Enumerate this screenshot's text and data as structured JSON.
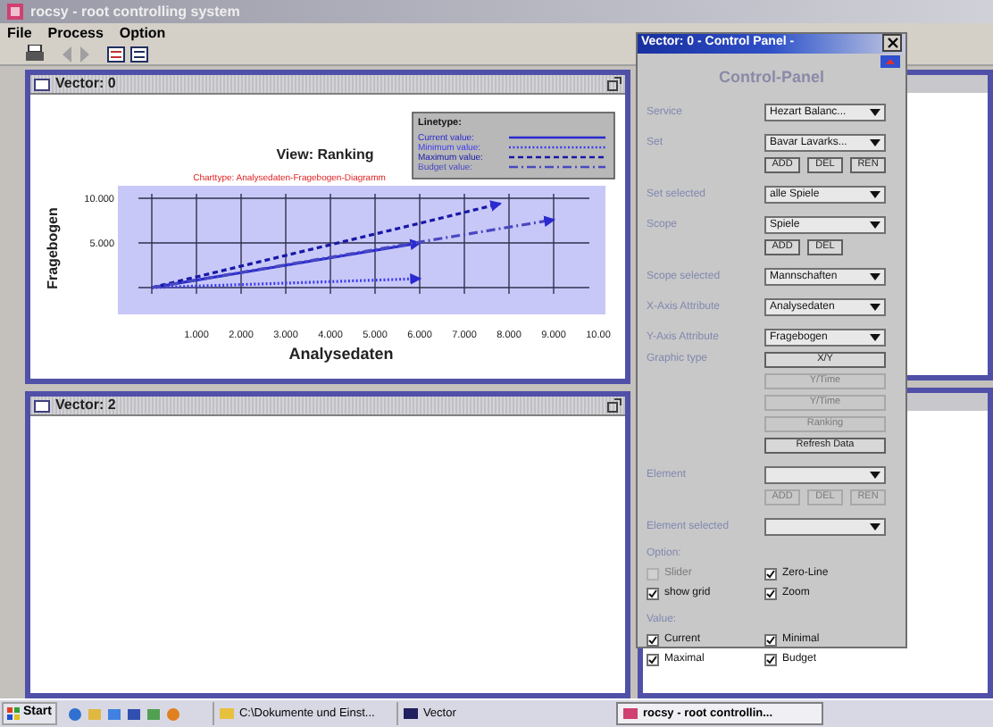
{
  "window": {
    "title": "rocsy - root controlling system"
  },
  "menu": [
    "File",
    "Process",
    "Option"
  ],
  "frames": [
    {
      "title": "Vector: 0",
      "kind": "chart",
      "caption": "Charttype: Analysedaten-Fragebogen-Diagramm",
      "legend_title": "Linetype:",
      "chart_data": {
        "type": "line",
        "title": "View: Ranking",
        "xlabel": "Analysedaten",
        "ylabel": "Fragebogen",
        "x": [
          0,
          6,
          7.8,
          9
        ],
        "series": [
          {
            "name": "Current value:",
            "color": "#2a2ad0",
            "line_style": "solid",
            "values": [
              0,
              5,
              null,
              null
            ]
          },
          {
            "name": "Minimum value:",
            "color": "#3c3cf0",
            "line_style": "dotted",
            "values": [
              0,
              1,
              null,
              null
            ]
          },
          {
            "name": "Maximum value:",
            "color": "#1818a8",
            "line_style": "dashed",
            "values": [
              0,
              7.2,
              9.4,
              null
            ]
          },
          {
            "name": "Budget value:",
            "color": "#4848c0",
            "line_style": "dashdot",
            "values": [
              0,
              5.1,
              6.6,
              7.6
            ]
          }
        ],
        "grid": true,
        "ref_lines": [
          {
            "axis": "x",
            "value": 0
          }
        ],
        "xlim": [
          -0.76,
          10.16
        ],
        "ylim": [
          -3,
          11.4
        ],
        "xticks": [
          {
            "value": 1,
            "label": "1.000"
          },
          {
            "value": 2,
            "label": "2.000"
          },
          {
            "value": 3,
            "label": "3.000"
          },
          {
            "value": 4,
            "label": "4.000"
          },
          {
            "value": 5,
            "label": "5.000"
          },
          {
            "value": 6,
            "label": "6.000"
          },
          {
            "value": 7,
            "label": "7.000"
          },
          {
            "value": 8,
            "label": "8.000"
          },
          {
            "value": 9,
            "label": "9.000"
          },
          {
            "value": 10,
            "label": "10.00"
          }
        ],
        "yticks": [
          {
            "value": 5,
            "label": "5.000"
          },
          {
            "value": 10,
            "label": "10.000"
          }
        ]
      }
    },
    {
      "title": "Vector: 2",
      "kind": "empty"
    }
  ],
  "panel": {
    "title": "Vector: 0  - Control Panel -",
    "heading": "Control-Panel",
    "rows": [
      {
        "kind": "combo",
        "label": "Service",
        "value": "Hezart Balanc..."
      },
      {
        "kind": "combo",
        "label": "Set",
        "value": "Bavar Lavarks..."
      },
      {
        "kind": "buttons",
        "buttons": [
          {
            "label": "ADD",
            "disabled": false
          },
          {
            "label": "DEL",
            "disabled": false
          },
          {
            "label": "REN",
            "disabled": false
          }
        ]
      },
      {
        "kind": "combo",
        "label": "Set selected",
        "value": "alle Spiele"
      },
      {
        "kind": "combo",
        "label": "Scope",
        "value": "Spiele"
      },
      {
        "kind": "buttons",
        "buttons": [
          {
            "label": "ADD",
            "disabled": false
          },
          {
            "label": "DEL",
            "disabled": false
          }
        ]
      },
      {
        "kind": "combo",
        "label": "Scope selected",
        "value": "Mannschaften"
      },
      {
        "kind": "combo",
        "label": "X-Axis Attribute",
        "value": "Analysedaten"
      },
      {
        "kind": "combo",
        "label": "Y-Axis Attribute",
        "value": "Fragebogen"
      },
      {
        "kind": "button",
        "label": "Graphic type",
        "button": {
          "label": "X/Y",
          "disabled": false
        }
      },
      {
        "kind": "button",
        "button": {
          "label": "Y/Time",
          "disabled": true
        }
      },
      {
        "kind": "button",
        "button": {
          "label": "Y/Time",
          "disabled": true
        }
      },
      {
        "kind": "button",
        "button": {
          "label": "Ranking",
          "disabled": true
        }
      },
      {
        "kind": "button",
        "button": {
          "label": "Refresh Data",
          "disabled": false
        }
      },
      {
        "kind": "combo",
        "label": "Element"
      },
      {
        "kind": "buttons",
        "buttons": [
          {
            "label": "ADD",
            "disabled": true
          },
          {
            "label": "DEL",
            "disabled": true
          },
          {
            "label": "REN",
            "disabled": true
          }
        ]
      },
      {
        "kind": "combo",
        "label": "Element selected"
      },
      {
        "kind": "heading",
        "label": "Option:"
      },
      {
        "kind": "checks",
        "items": [
          {
            "label": "Slider",
            "checked": false,
            "disabled": true
          },
          {
            "label": "Zero-Line",
            "checked": true,
            "disabled": false
          }
        ]
      },
      {
        "kind": "checks",
        "items": [
          {
            "label": "show grid",
            "checked": true,
            "disabled": false
          },
          {
            "label": "Zoom",
            "checked": true,
            "disabled": false
          }
        ]
      },
      {
        "kind": "heading",
        "label": "Value:"
      },
      {
        "kind": "checks",
        "items": [
          {
            "label": "Current",
            "checked": true,
            "disabled": false
          },
          {
            "label": "Minimal",
            "checked": true,
            "disabled": false
          }
        ]
      },
      {
        "kind": "checks",
        "items": [
          {
            "label": "Maximal",
            "checked": true,
            "disabled": false
          },
          {
            "label": "Budget",
            "checked": true,
            "disabled": false
          }
        ]
      }
    ]
  },
  "taskbar": {
    "start": "Start",
    "tasks": [
      {
        "label": "C:\\Dokumente und Einst...",
        "kind": "folder",
        "selected": false
      },
      {
        "label": "Vector",
        "kind": "console",
        "selected": false
      },
      {
        "label": "rocsy - root controllin...",
        "kind": "app",
        "selected": true
      }
    ]
  }
}
